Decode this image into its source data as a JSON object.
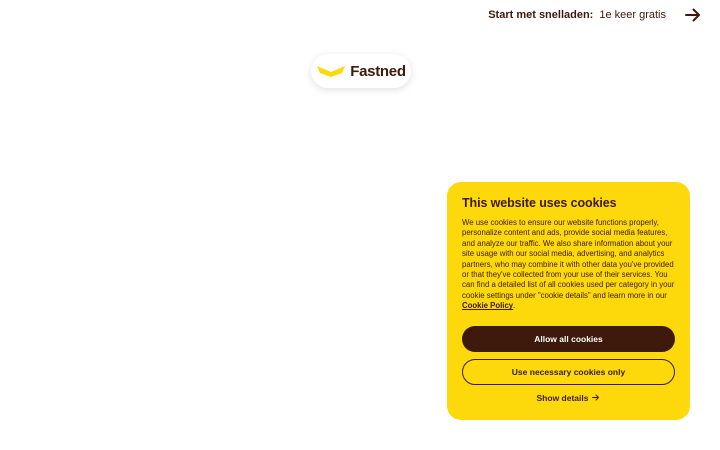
{
  "promo": {
    "label_bold": "Start met snelladen:",
    "label_rest": "1e keer gratis",
    "arrow_icon": "arrow-right-icon"
  },
  "logo": {
    "text": "Fastned",
    "mark_color": "#fdd90c"
  },
  "cookie_banner": {
    "title": "This website uses cookies",
    "body": "We use cookies to ensure our website functions properly, personalize content and ads, provide social media features, and analyze our traffic. We also share information about your site usage with our social media, advertising, and analytics partners, who may combine it with other data you've provided or that they've collected from your use of their services. You can find a detailed list of all cookies used per category in your cookie settings under \"cookie details\" and learn more in our",
    "policy_link": "Cookie Policy",
    "allow_all_label": "Allow all cookies",
    "necessary_only_label": "Use necessary cookies only",
    "show_details_label": "Show details",
    "background_color": "#fdd90c",
    "text_color": "#3d1a0c"
  }
}
